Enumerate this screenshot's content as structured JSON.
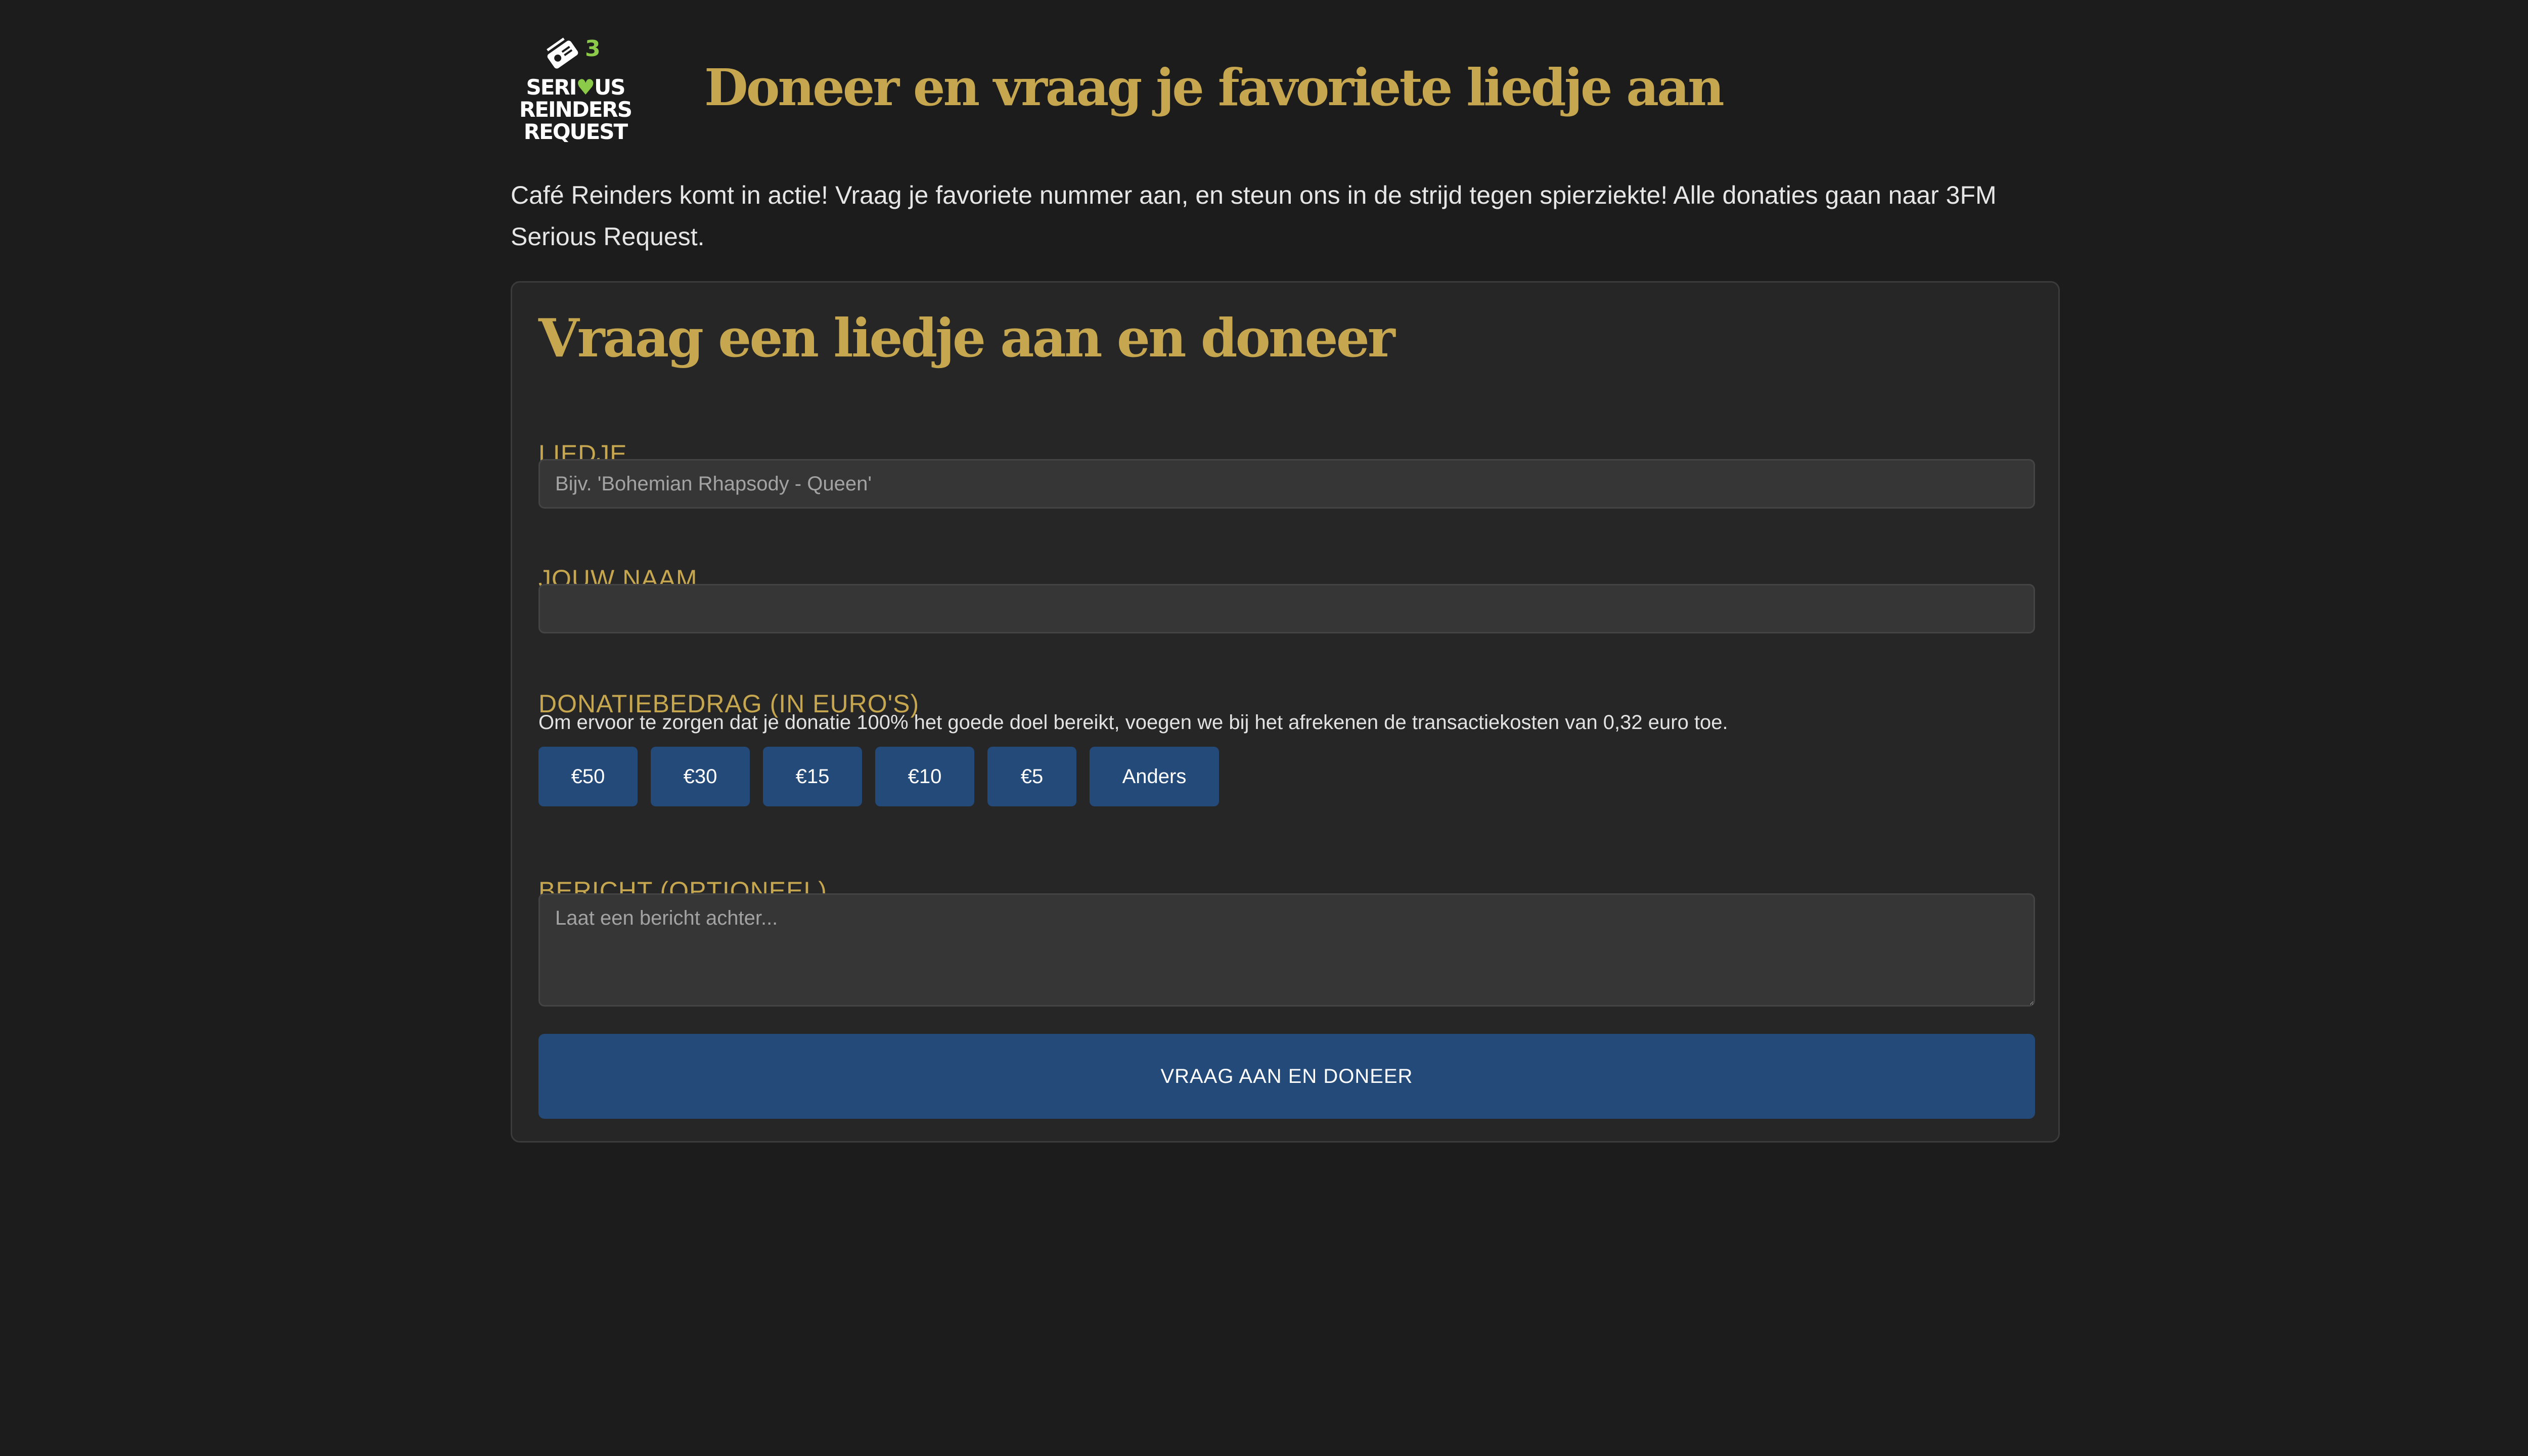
{
  "header": {
    "logo_lines": [
      "SERI",
      "US",
      "REINDERS",
      "REQUEST"
    ],
    "logo_heart": "♥",
    "logo_badge": "3",
    "title": "Doneer en vraag je favoriete liedje aan"
  },
  "intro": "Café Reinders komt in actie! Vraag je favoriete nummer aan, en steun ons in de strijd tegen spierziekte! Alle donaties gaan naar 3FM Serious Request.",
  "form": {
    "title": "Vraag een liedje aan en doneer",
    "song": {
      "label": "LIEDJE",
      "placeholder": "Bijv. 'Bohemian Rhapsody - Queen'",
      "value": ""
    },
    "name": {
      "label": "JOUW NAAM",
      "placeholder": "",
      "value": ""
    },
    "amount": {
      "label": "DONATIEBEDRAG (IN EURO'S)",
      "note": "Om ervoor te zorgen dat je donatie 100% het goede doel bereikt, voegen we bij het afrekenen de transactiekosten van 0,32 euro toe.",
      "options": [
        "€50",
        "€30",
        "€15",
        "€10",
        "€5",
        "Anders"
      ]
    },
    "message": {
      "label": "BERICHT (OPTIONEEL)",
      "placeholder": "Laat een bericht achter..."
    },
    "submit_label": "VRAAG AAN EN DONEER"
  },
  "colors": {
    "background": "#1c1c1c",
    "card": "#262626",
    "gold": "#c6a74f",
    "button_blue": "#244a7a",
    "logo_heart": "#8ccb4a"
  }
}
